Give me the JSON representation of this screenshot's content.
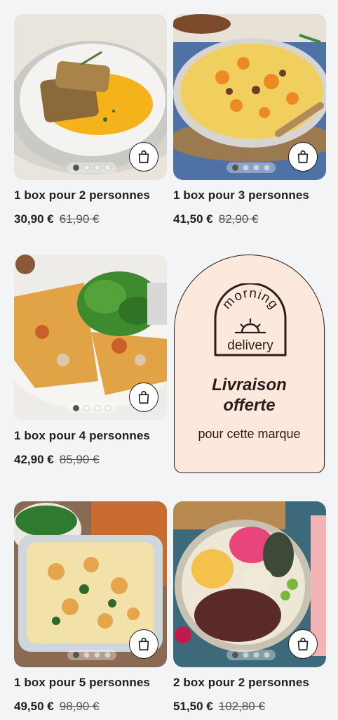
{
  "products": [
    {
      "title": "1 box pour 2 personnes",
      "price": "30,90 €",
      "old_price": "61,90 €"
    },
    {
      "title": "1 box pour 3 personnes",
      "price": "41,50 €",
      "old_price": "82,90 €"
    },
    {
      "title": "1 box pour 4 personnes",
      "price": "42,90 €",
      "old_price": "85,90 €"
    },
    {
      "title": "1 box pour 5 personnes",
      "price": "49,50 €",
      "old_price": "98,90 €"
    },
    {
      "title": "2 box pour 2 personnes",
      "price": "51,50 €",
      "old_price": "102,80 €"
    }
  ],
  "promo": {
    "logo_top": "morning",
    "logo_bottom": "delivery",
    "title_line1": "Livraison",
    "title_line2": "offerte",
    "subtitle": "pour cette marque"
  },
  "icons": {
    "cart": "shopping-bag-icon",
    "carousel": "carousel-dots"
  },
  "colors": {
    "promo_bg": "#fde8dd",
    "promo_border": "#2a1d1a",
    "page_bg": "#f2f4f5"
  }
}
